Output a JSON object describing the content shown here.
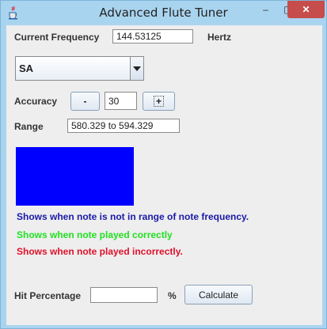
{
  "window": {
    "title": "Advanced Flute Tuner",
    "close_label": "✕",
    "minimize_label": "–",
    "maximize_label": "▢"
  },
  "frequency": {
    "label": "Current Frequency",
    "value": "144.53125",
    "unit": "Hertz"
  },
  "note_select": {
    "selected": "SA"
  },
  "accuracy": {
    "label": "Accuracy",
    "minus_label": "-",
    "value": "30",
    "plus_label": "+"
  },
  "range": {
    "label": "Range",
    "value": "580.329 to 594.329"
  },
  "indicator": {
    "color": "#0000ff"
  },
  "legend": {
    "not_in_range": "Shows when note is not in range of note frequency.",
    "correct": "Shows when note played correctly",
    "incorrect": "Shows when note played incorrectly.",
    "colors": {
      "not_in_range": "#1a1aa8",
      "correct": "#22e022",
      "incorrect": "#e0102a"
    }
  },
  "hit": {
    "label": "Hit Percentage",
    "value": "",
    "unit": "%",
    "calculate_label": "Calculate"
  }
}
